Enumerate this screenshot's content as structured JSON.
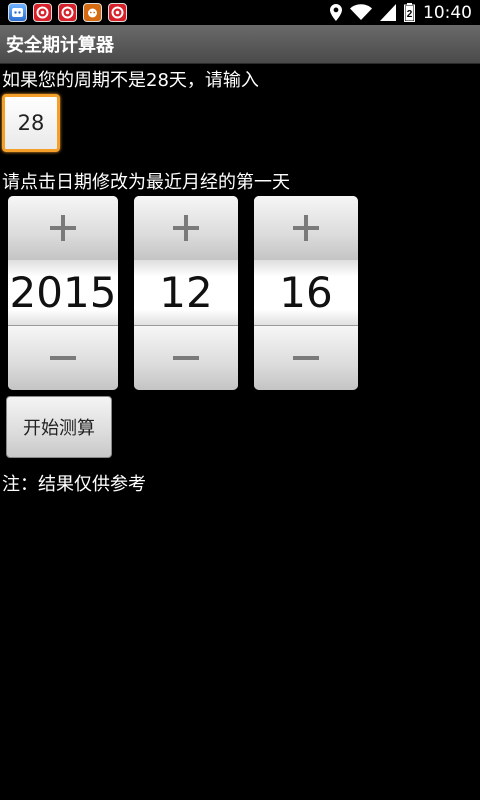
{
  "status_bar": {
    "notification_icons": [
      "app-icon",
      "app-icon",
      "app-icon",
      "app-icon",
      "app-icon"
    ],
    "time": "10:40",
    "battery_level": "2"
  },
  "titlebar": {
    "title": "安全期计算器"
  },
  "cycle": {
    "label": "如果您的周期不是28天，请输入",
    "value": "28"
  },
  "date": {
    "label": "请点击日期修改为最近月经的第一天",
    "year": "2015",
    "month": "12",
    "day": "16"
  },
  "actions": {
    "calculate_label": "开始测算"
  },
  "note": "注：结果仅供参考",
  "colors": {
    "background": "#000000",
    "titlebar": "#555555",
    "focus_accent": "#f59f2b"
  }
}
